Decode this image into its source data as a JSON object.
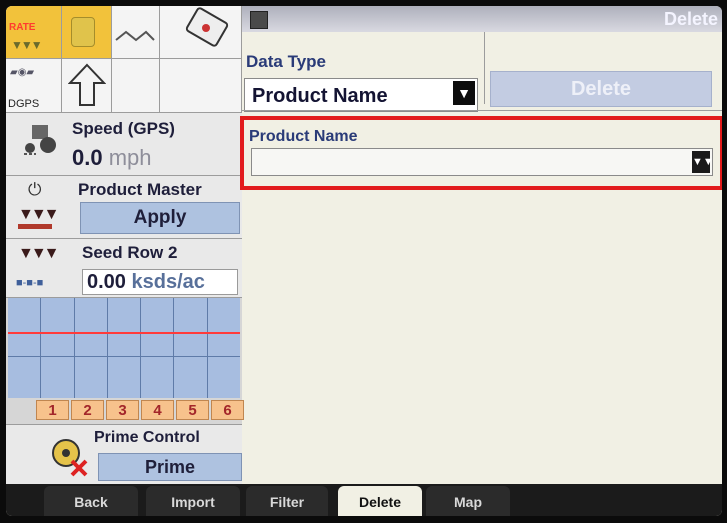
{
  "left_panel": {
    "tiles_row1": {
      "rate": "RATE"
    },
    "tiles_row2": {
      "dgps": "DGPS"
    },
    "speed": {
      "title": "Speed (GPS)",
      "value": "0.0",
      "unit": "mph"
    },
    "product_master": {
      "title": "Product Master",
      "button": "Apply"
    },
    "seed_row": {
      "title": "Seed Row 2",
      "value": "0.00",
      "unit": "ksds/ac"
    },
    "row_numbers": [
      "1",
      "2",
      "3",
      "4",
      "5",
      "6"
    ],
    "prime_control": {
      "title": "Prime Control",
      "button": "Prime"
    }
  },
  "header": {
    "title": "Delete"
  },
  "form": {
    "data_type_label": "Data Type",
    "data_type_value": "Product Name",
    "delete_button": "Delete",
    "product_name_label": "Product Name",
    "product_name_value": ""
  },
  "tabs": [
    "Back",
    "Import",
    "Filter",
    "Delete",
    "Map"
  ],
  "active_tab": "Delete",
  "colors": {
    "highlight": "#e21b1b",
    "accent": "#2a3b78"
  }
}
